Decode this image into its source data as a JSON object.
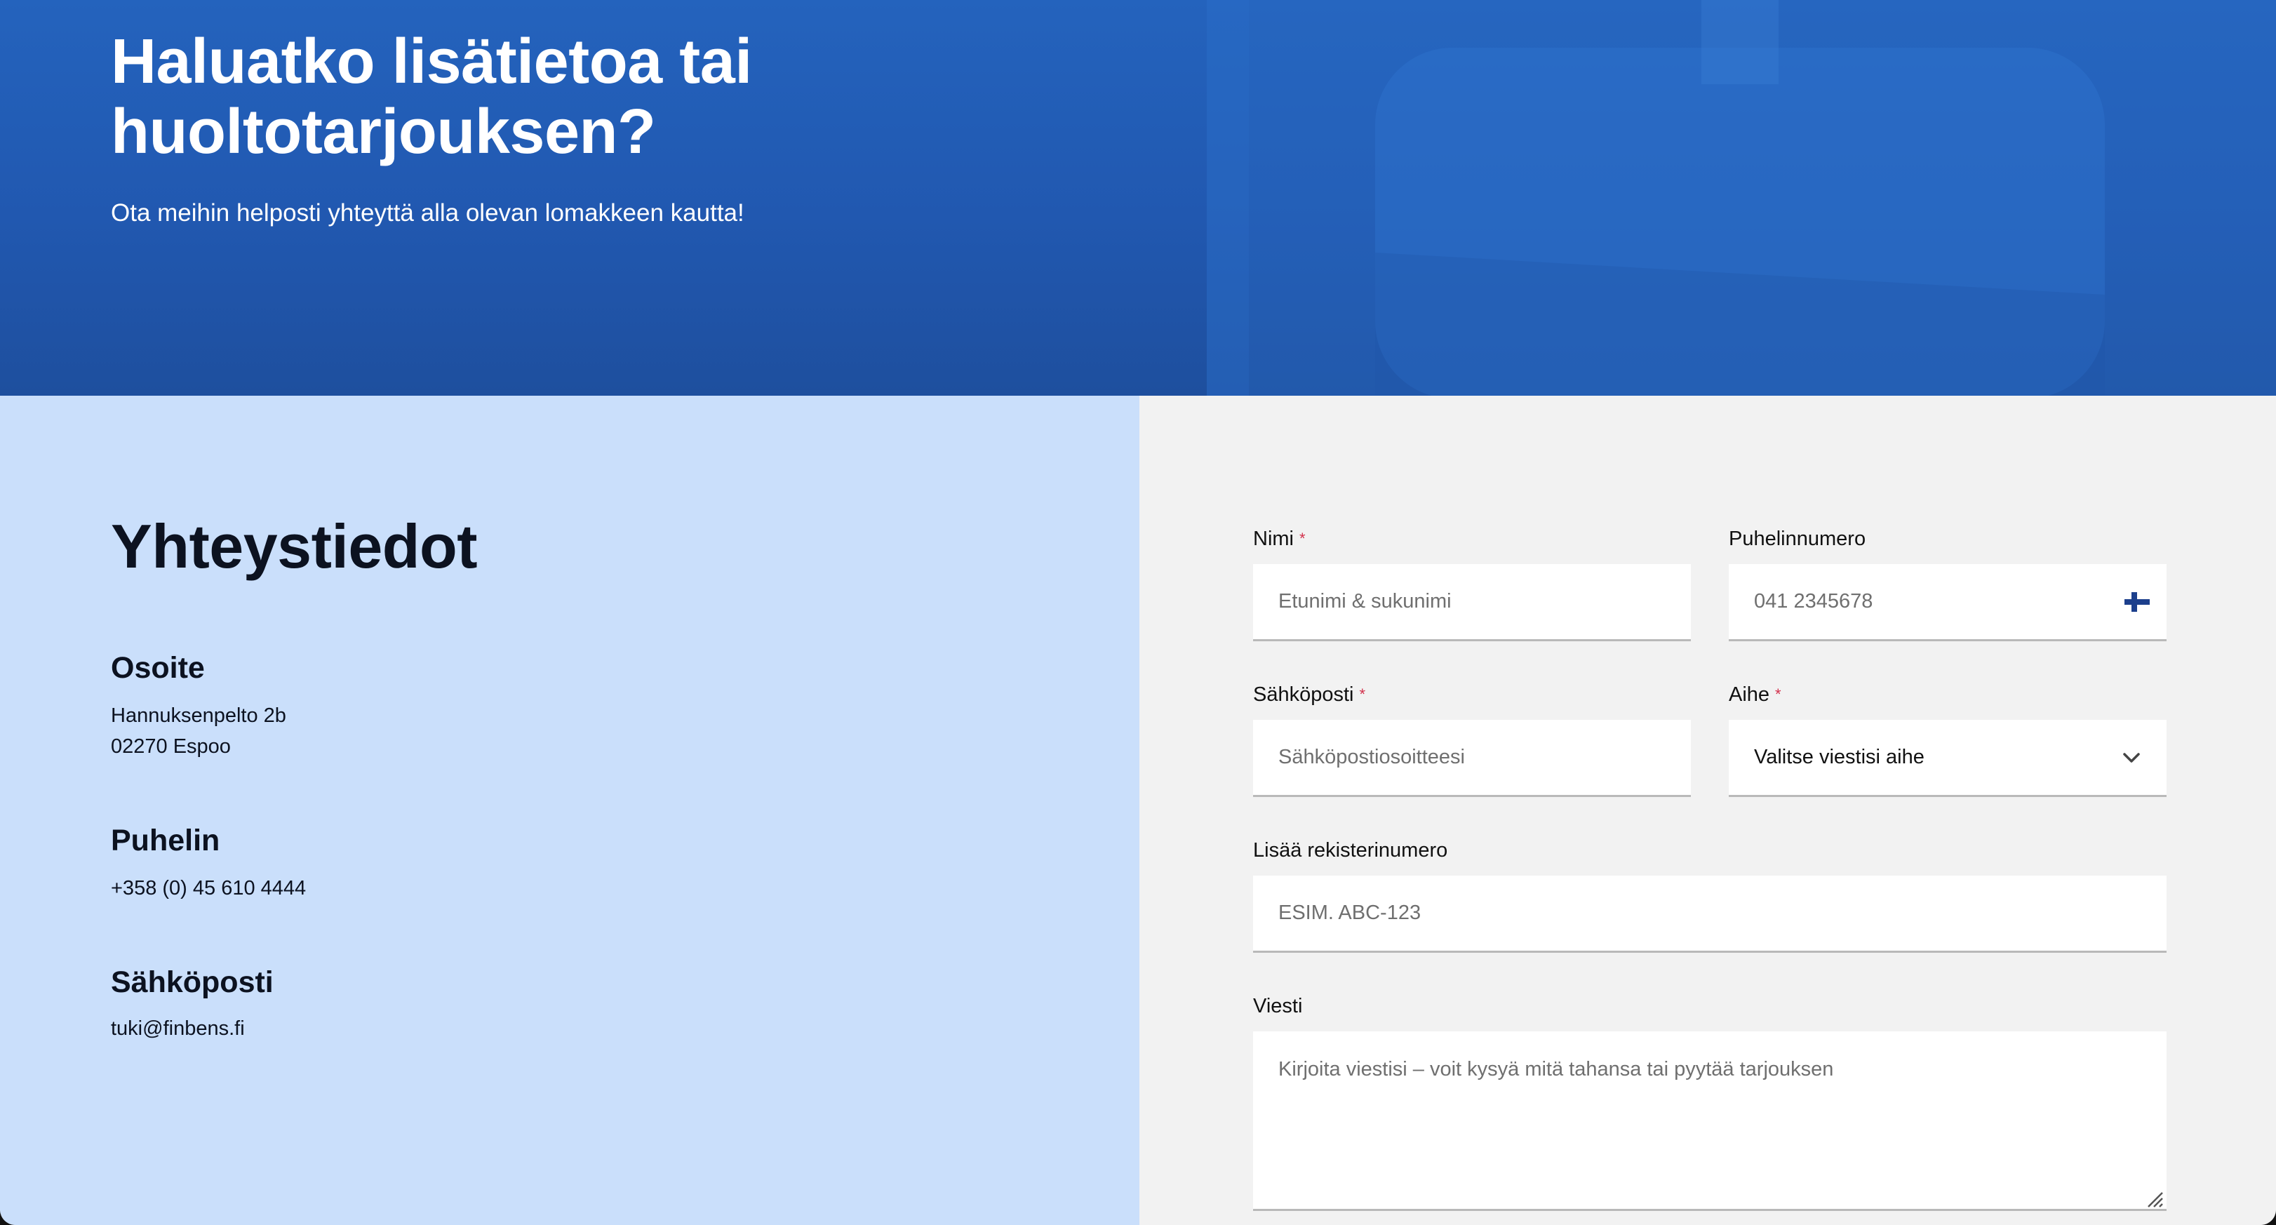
{
  "hero": {
    "title_line1": "Haluatko lisätietoa tai",
    "title_line2": "huoltotarjouksen?",
    "subtitle": "Ota meihin helposti yhteyttä alla olevan lomakkeen kautta!"
  },
  "contact": {
    "title": "Yhteystiedot",
    "address_heading": "Osoite",
    "address_line1": "Hannuksenpelto 2b",
    "address_line2": "02270 Espoo",
    "phone_heading": "Puhelin",
    "phone": "+358 (0) 45 610 4444",
    "email_heading": "Sähköposti",
    "email": "tuki@finbens.fi"
  },
  "form": {
    "name_label": "Nimi",
    "name_placeholder": "Etunimi & sukunimi",
    "phone_label": "Puhelinnumero",
    "phone_placeholder": "041 2345678",
    "email_label": "Sähköposti",
    "email_placeholder": "Sähköpostiosoitteesi",
    "subject_label": "Aihe",
    "subject_value": "Valitse viestisi aihe",
    "reg_label": "Lisää rekisterinumero",
    "reg_placeholder": "ESIM. ABC-123",
    "message_label": "Viesti",
    "message_placeholder": "Kirjoita viestisi – voit kysyä mitä tahansa tai pyytää tarjouksen",
    "required_mark": "*"
  },
  "colors": {
    "hero_blue": "#2463bd",
    "contact_panel": "#cadffb",
    "form_bg": "#f2f2f2",
    "required": "#d2304b",
    "flag_blue": "#1c3f8c"
  },
  "icons": {
    "phone_country": "finland-flag-icon",
    "subject_dropdown": "chevron-down-icon",
    "textarea_resize": "resize-handle-icon"
  }
}
